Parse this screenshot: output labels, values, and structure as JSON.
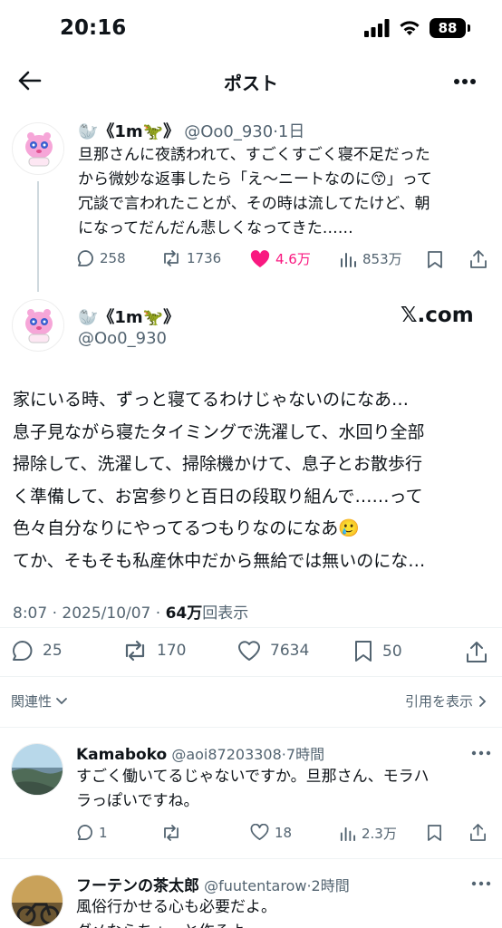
{
  "status": {
    "time": "20:16",
    "battery": "88"
  },
  "nav": {
    "title": "ポスト"
  },
  "quoted": {
    "name": "🦭《1m🦖》",
    "handle": "@Oo0_930",
    "age": "·1日",
    "lines": [
      "旦那さんに夜誘われて、すごくすごく寝不足だった",
      "から微妙な返事したら「え〜ニートなのに😙」って",
      "冗談で言われたことが、その時は流してたけど、朝",
      "になってだんだん悲しくなってきた……"
    ],
    "replies": "258",
    "reposts": "1736",
    "likes": "4.6万",
    "views": "853万"
  },
  "main": {
    "name": "🦭《1m🦖》",
    "handle": "@Oo0_930",
    "watermark": "𝕏.com",
    "lines": [
      "家にいる時、ずっと寝てるわけじゃないのになあ…",
      "息子見ながら寝たタイミングで洗濯して、水回り全部",
      "掃除して、洗濯して、掃除機かけて、息子とお散歩行",
      "く準備して、お宮参りと百日の段取り組んで……って",
      "色々自分なりにやってるつもりなのになあ🥲",
      "てか、そもそも私産休中だから無給では無いのにな…"
    ],
    "meta_time": "8:07 · 2025/10/07 · ",
    "meta_views": "64万",
    "meta_views_label": "回表示",
    "replies": "25",
    "reposts": "170",
    "likes": "7634",
    "bookmarks": "50",
    "sort_label": "関連性",
    "quotes_label": "引用を表示"
  },
  "reply1": {
    "name": "Kamaboko",
    "handle": "@aoi87203308",
    "age": "·7時間",
    "lines": [
      "すごく働いてるじゃないですか。旦那さん、モラハ",
      "ラっぽいですね。"
    ],
    "replies": "1",
    "reposts": "",
    "likes": "18",
    "views": "2.3万"
  },
  "reply2": {
    "name": "フーテンの茶太郎",
    "handle": "@fuutentarow",
    "age": "·2時間",
    "lines": [
      "風俗行かせる心も必要だよ。",
      "ダメならちょっと作るよ"
    ]
  }
}
